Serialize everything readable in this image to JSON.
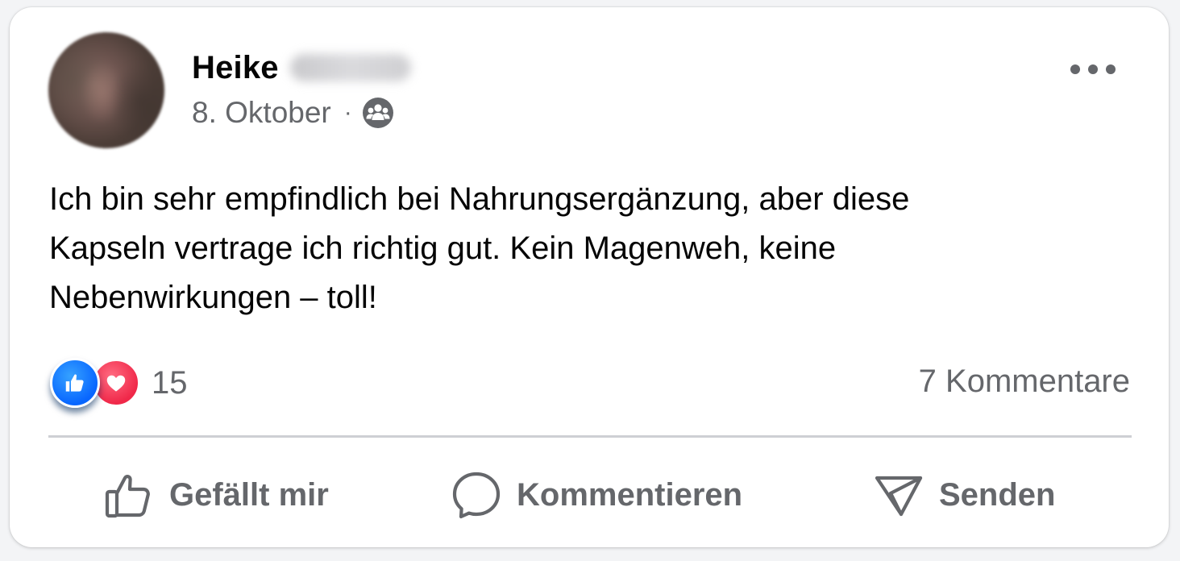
{
  "post": {
    "author_first_name": "Heike",
    "date": "8. Oktober",
    "meta_separator": "·",
    "audience_icon": "group-icon",
    "text": "Ich bin sehr empfindlich bei Nahrungsergänzung, aber diese\nKapseln vertrage ich richtig gut. Kein Magenweh, keine\nNebenwirkungen – toll!",
    "more_icon": "more-horizontal-icon"
  },
  "reactions": {
    "types": [
      "like",
      "love"
    ],
    "count": "15",
    "comments_label": "7 Kommentare"
  },
  "actions": {
    "like_label": "Gefällt mir",
    "like_icon": "thumbs-up-icon",
    "comment_label": "Kommentieren",
    "comment_icon": "comment-bubble-icon",
    "send_label": "Senden",
    "send_icon": "send-icon"
  },
  "colors": {
    "like_blue": "#0866ff",
    "love_red": "#f02849",
    "secondary_text": "#65676b",
    "primary_text": "#050505",
    "divider": "#ced0d4"
  }
}
